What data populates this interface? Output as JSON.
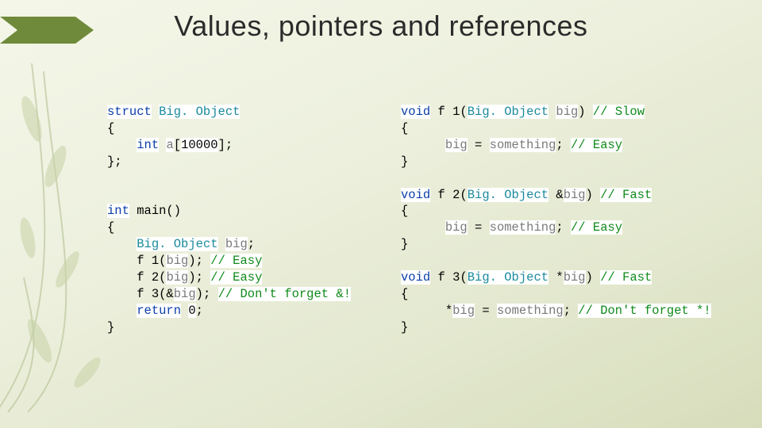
{
  "slide": {
    "title": "Values, pointers and references"
  },
  "codeLeft": {
    "struct": {
      "l1_a": "struct",
      "l1_b": "Big. Object",
      "l2": "{",
      "l3_a": "int",
      "l3_b": "a",
      "l3_c": "[",
      "l3_d": "10000",
      "l3_e": "];",
      "l4": "};"
    },
    "main": {
      "l1_a": "int",
      "l1_b": "main()",
      "l2": "{",
      "l3_a": "Big. Object",
      "l3_b": "big",
      "l4_a": "f 1(",
      "l4_b": "big",
      "l4_c": ");",
      "l4_d": "// Easy",
      "l5_a": "f 2(",
      "l5_b": "big",
      "l5_c": ");",
      "l5_d": "// Easy",
      "l6_a": "f 3(&",
      "l6_b": "big",
      "l6_c": ");",
      "l6_d": "// Don't forget &!",
      "l7_a": "return",
      "l7_b": "0",
      "l8": "}"
    }
  },
  "codeRight": {
    "f1": {
      "l1_a": "void",
      "l1_b": "f 1(",
      "l1_c": "Big. Object",
      "l1_d": "big",
      "l1_e": ")",
      "l1_f": "// Slow",
      "l2": "{",
      "l3_a": "big",
      "l3_b": "=",
      "l3_c": "something",
      "l3_d": "// Easy",
      "l4": "}"
    },
    "f2": {
      "l1_a": "void",
      "l1_b": "f 2(",
      "l1_c": "Big. Object",
      "l1_d": "&",
      "l1_e": "big",
      "l1_f": ")",
      "l1_g": "// Fast",
      "l2": "{",
      "l3_a": "big",
      "l3_b": "=",
      "l3_c": "something",
      "l3_d": "// Easy",
      "l4": "}"
    },
    "f3": {
      "l1_a": "void",
      "l1_b": "f 3(",
      "l1_c": "Big. Object",
      "l1_d": "*",
      "l1_e": "big",
      "l1_f": ")",
      "l1_g": "// Fast",
      "l2": "{",
      "l3_a": "*",
      "l3_b": "big",
      "l3_c": "=",
      "l3_d": "something",
      "l3_e": "// Don't forget *!",
      "l4": "}"
    }
  }
}
